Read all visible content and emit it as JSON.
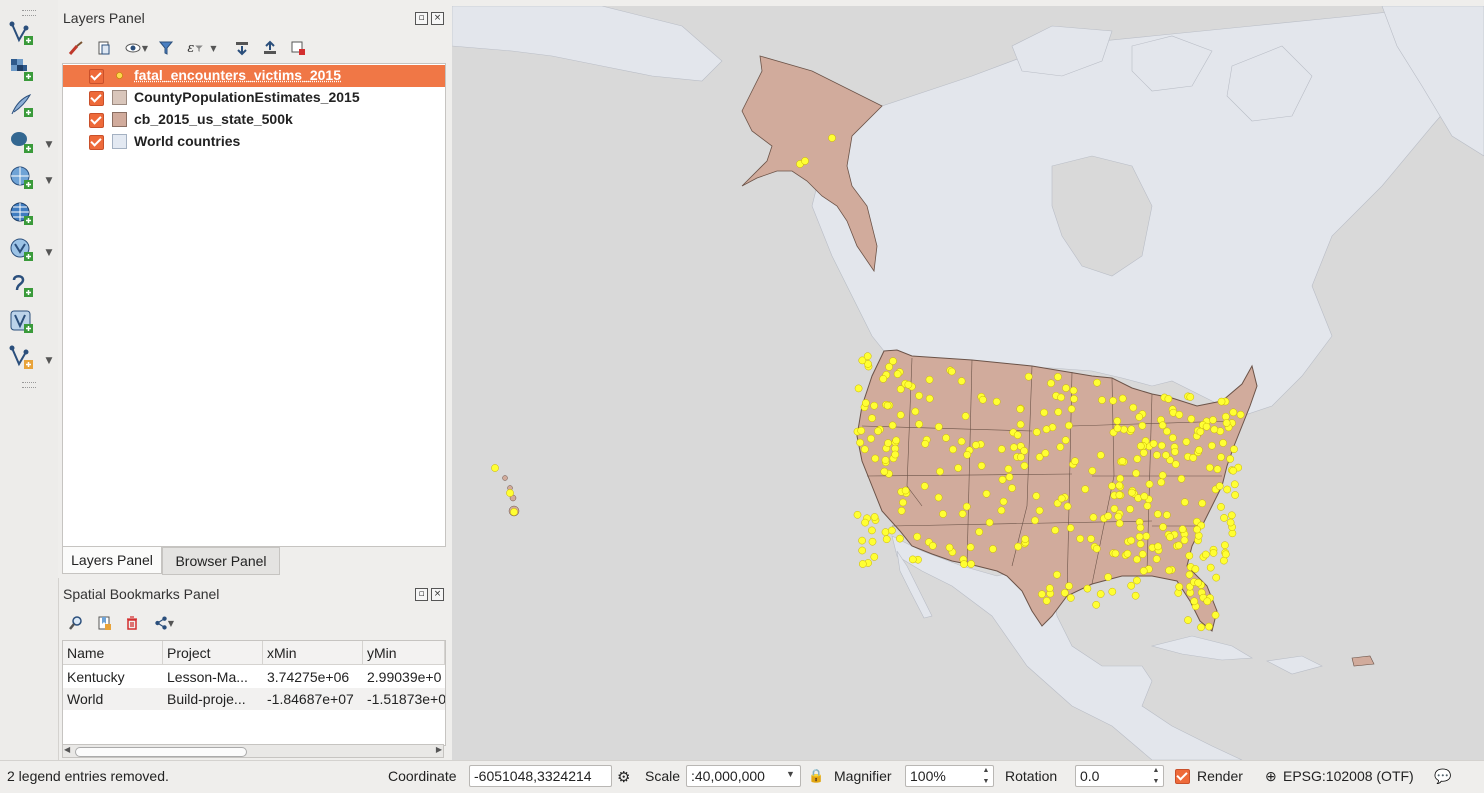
{
  "layers_panel": {
    "title": "Layers Panel",
    "layers": [
      {
        "name": "fatal_encounters_victims_2015",
        "symbol": "yellow-point",
        "checked": true,
        "selected": true
      },
      {
        "name": "CountyPopulationEstimates_2015",
        "symbol": "tan-fill",
        "checked": true,
        "selected": false
      },
      {
        "name": "cb_2015_us_state_500k",
        "symbol": "tan-fill",
        "checked": true,
        "selected": false
      },
      {
        "name": "World countries",
        "symbol": "light-blue-fill",
        "checked": true,
        "selected": false
      }
    ],
    "tabs": [
      "Layers Panel",
      "Browser Panel"
    ],
    "active_tab": "Layers Panel"
  },
  "bookmarks_panel": {
    "title": "Spatial Bookmarks Panel",
    "columns": [
      "Name",
      "Project",
      "xMin",
      "yMin"
    ],
    "rows": [
      [
        "Kentucky",
        "Lesson-Ma...",
        "3.74275e+06",
        "2.99039e+0"
      ],
      [
        "World",
        "Build-proje...",
        "-1.84687e+07",
        "-1.51873e+0"
      ]
    ]
  },
  "status_bar": {
    "message": "2 legend entries removed.",
    "coordinate_label": "Coordinate",
    "coordinate_value": "-6051048,3324214",
    "scale_label": "Scale",
    "scale_value": ":40,000,000",
    "magnifier_label": "Magnifier",
    "magnifier_value": "100%",
    "rotation_label": "Rotation",
    "rotation_value": "0.0",
    "render_label": "Render",
    "render_checked": true,
    "crs": "EPSG:102008 (OTF)"
  },
  "colors": {
    "selection": "#f07746",
    "state_fill": "#d1ab9c",
    "land": "#e3e6ec",
    "ocean": "#d9d9d9",
    "points": "#ffff33"
  }
}
